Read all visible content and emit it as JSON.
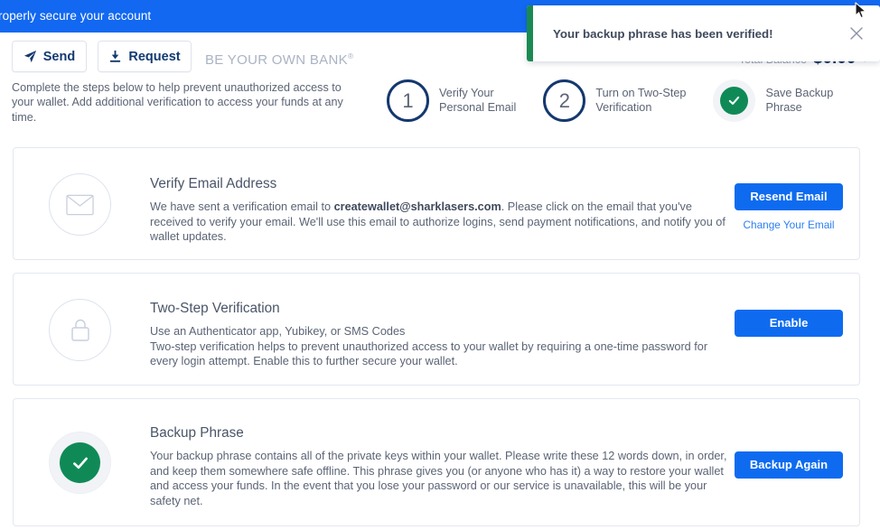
{
  "banner": {
    "text": "roperly secure your account"
  },
  "actionbar": {
    "send_label": "Send",
    "request_label": "Request",
    "tagline": "BE YOUR OWN BANK",
    "tagline_mark": "®"
  },
  "balance": {
    "label": "Total Balance",
    "value": "$0.00",
    "caret": "▾"
  },
  "intro": {
    "text": "Complete the steps below to help prevent unauthorized access to your wallet. Add additional verification to access your funds at any time."
  },
  "steps": [
    {
      "number": "1",
      "label": "Verify Your\nPersonal Email",
      "state": "pending"
    },
    {
      "number": "2",
      "label": "Turn on Two-Step\nVerification",
      "state": "pending"
    },
    {
      "number": "",
      "label": "Save Backup\nPhrase",
      "state": "done"
    }
  ],
  "cards": [
    {
      "id": "email",
      "icon": "envelope-icon",
      "title": "Verify Email Address",
      "desc_pre": "We have sent a verification email to ",
      "desc_bold": "createwallet@sharklasers.com",
      "desc_post": ". Please click on the email that you've received to verify your email. We'll use this email to authorize logins, send payment notifications, and notify you of wallet updates.",
      "button": "Resend Email",
      "link": "Change Your Email"
    },
    {
      "id": "twostep",
      "icon": "lock-icon",
      "title": "Two-Step Verification",
      "desc_pre": "Use an Authenticator app, Yubikey, or SMS Codes\nTwo-step verification helps to prevent unauthorized access to your wallet by requiring a one-time password for every login attempt. Enable this to further secure your wallet.",
      "desc_bold": "",
      "desc_post": "",
      "button": "Enable",
      "link": ""
    },
    {
      "id": "backup",
      "icon": "check-circle-icon",
      "title": "Backup Phrase",
      "desc_pre": "Your backup phrase contains all of the private keys within your wallet. Please write these 12 words down, in order, and keep them somewhere safe offline. This phrase gives you (or anyone who has it) a way to restore your wallet and access your funds. In the event that you lose your password or our service is unavailable, this will be your safety net.",
      "desc_bold": "",
      "desc_post": "",
      "button": "Backup Again",
      "link": ""
    }
  ],
  "toast": {
    "message": "Your backup phrase has been verified!",
    "accent_color": "#1b8a52",
    "close_icon": "close-icon"
  },
  "colors": {
    "banner_blue": "#1268f1",
    "button_blue": "#0e6bf0",
    "link_blue": "#2d7ff4",
    "success_green": "#0f8a57",
    "navy": "#14386e",
    "body_text": "#5b6475"
  }
}
